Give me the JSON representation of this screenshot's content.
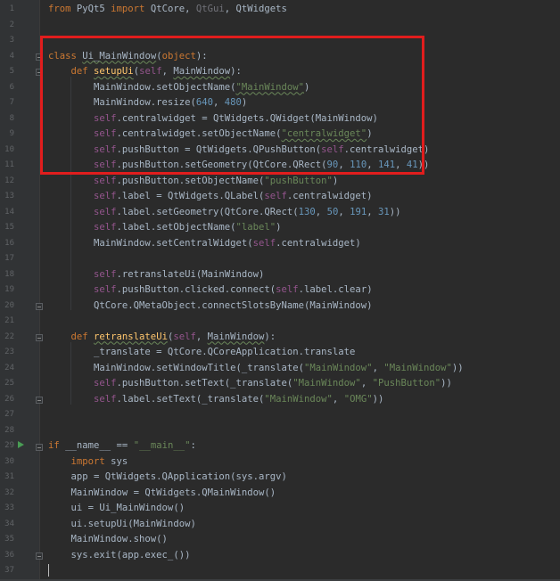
{
  "editor": {
    "line_numbers": [
      "1",
      "2",
      "3",
      "4",
      "5",
      "6",
      "7",
      "8",
      "9",
      "10",
      "11",
      "12",
      "13",
      "14",
      "15",
      "16",
      "17",
      "18",
      "19",
      "20",
      "21",
      "22",
      "23",
      "24",
      "25",
      "26",
      "27",
      "28",
      "29",
      "30",
      "31",
      "32",
      "33",
      "34",
      "35",
      "36",
      "37"
    ],
    "lines": [
      {
        "n": "1",
        "tokens": [
          {
            "t": "from ",
            "c": "kw"
          },
          {
            "t": "PyQt5 "
          },
          {
            "t": "import ",
            "c": "kw"
          },
          {
            "t": "QtCore, "
          },
          {
            "t": "QtGui",
            "c": "param"
          },
          {
            "t": ", QtWidgets"
          }
        ]
      },
      {
        "n": "2",
        "tokens": []
      },
      {
        "n": "3",
        "tokens": []
      },
      {
        "n": "4",
        "tokens": [
          {
            "t": "class ",
            "c": "kw"
          },
          {
            "t": "Ui_MainWindow",
            "c": "wave"
          },
          {
            "t": "("
          },
          {
            "t": "object",
            "c": "kw"
          },
          {
            "t": "):"
          }
        ]
      },
      {
        "n": "5",
        "tokens": [
          {
            "t": "    "
          },
          {
            "t": "def ",
            "c": "kw"
          },
          {
            "t": "setupUi",
            "c": "fn wave"
          },
          {
            "t": "("
          },
          {
            "t": "self",
            "c": "self"
          },
          {
            "t": ", "
          },
          {
            "t": "MainWindow",
            "c": "wave"
          },
          {
            "t": "):"
          }
        ]
      },
      {
        "n": "6",
        "tokens": [
          {
            "t": "        MainWindow.setObjectName("
          },
          {
            "t": "\"MainWindow\"",
            "c": "str wave"
          },
          {
            "t": ")"
          }
        ]
      },
      {
        "n": "7",
        "tokens": [
          {
            "t": "        MainWindow.resize("
          },
          {
            "t": "640",
            "c": "num"
          },
          {
            "t": ", "
          },
          {
            "t": "480",
            "c": "num"
          },
          {
            "t": ")"
          }
        ]
      },
      {
        "n": "8",
        "tokens": [
          {
            "t": "        "
          },
          {
            "t": "self",
            "c": "self"
          },
          {
            "t": ".centralwidget = QtWidgets.QWidget(MainWindow)"
          }
        ]
      },
      {
        "n": "9",
        "tokens": [
          {
            "t": "        "
          },
          {
            "t": "self",
            "c": "self"
          },
          {
            "t": ".centralwidget.setObjectName("
          },
          {
            "t": "\"centralwidget\"",
            "c": "str wave"
          },
          {
            "t": ")"
          }
        ]
      },
      {
        "n": "10",
        "tokens": [
          {
            "t": "        "
          },
          {
            "t": "self",
            "c": "self"
          },
          {
            "t": ".pushButton = QtWidgets.QPushButton("
          },
          {
            "t": "self",
            "c": "self"
          },
          {
            "t": ".centralwidget)"
          }
        ]
      },
      {
        "n": "11",
        "tokens": [
          {
            "t": "        "
          },
          {
            "t": "self",
            "c": "self"
          },
          {
            "t": ".pushButton.setGeometry(QtCore.QRect("
          },
          {
            "t": "90",
            "c": "num"
          },
          {
            "t": ", "
          },
          {
            "t": "110",
            "c": "num"
          },
          {
            "t": ", "
          },
          {
            "t": "141",
            "c": "num"
          },
          {
            "t": ", "
          },
          {
            "t": "41",
            "c": "num"
          },
          {
            "t": "))"
          }
        ]
      },
      {
        "n": "12",
        "tokens": [
          {
            "t": "        "
          },
          {
            "t": "self",
            "c": "self"
          },
          {
            "t": ".pushButton.setObjectName("
          },
          {
            "t": "\"pushButton\"",
            "c": "str"
          },
          {
            "t": ")"
          }
        ]
      },
      {
        "n": "13",
        "tokens": [
          {
            "t": "        "
          },
          {
            "t": "self",
            "c": "self"
          },
          {
            "t": ".label = QtWidgets.QLabel("
          },
          {
            "t": "self",
            "c": "self"
          },
          {
            "t": ".centralwidget)"
          }
        ]
      },
      {
        "n": "14",
        "tokens": [
          {
            "t": "        "
          },
          {
            "t": "self",
            "c": "self"
          },
          {
            "t": ".label.setGeometry(QtCore.QRect("
          },
          {
            "t": "130",
            "c": "num"
          },
          {
            "t": ", "
          },
          {
            "t": "50",
            "c": "num"
          },
          {
            "t": ", "
          },
          {
            "t": "191",
            "c": "num"
          },
          {
            "t": ", "
          },
          {
            "t": "31",
            "c": "num"
          },
          {
            "t": "))"
          }
        ]
      },
      {
        "n": "15",
        "tokens": [
          {
            "t": "        "
          },
          {
            "t": "self",
            "c": "self"
          },
          {
            "t": ".label.setObjectName("
          },
          {
            "t": "\"label\"",
            "c": "str"
          },
          {
            "t": ")"
          }
        ]
      },
      {
        "n": "16",
        "tokens": [
          {
            "t": "        MainWindow.setCentralWidget("
          },
          {
            "t": "self",
            "c": "self"
          },
          {
            "t": ".centralwidget)"
          }
        ]
      },
      {
        "n": "17",
        "tokens": []
      },
      {
        "n": "18",
        "tokens": [
          {
            "t": "        "
          },
          {
            "t": "self",
            "c": "self"
          },
          {
            "t": ".retranslateUi(MainWindow)"
          }
        ]
      },
      {
        "n": "19",
        "tokens": [
          {
            "t": "        "
          },
          {
            "t": "self",
            "c": "self"
          },
          {
            "t": ".pushButton.clicked.connect("
          },
          {
            "t": "self",
            "c": "self"
          },
          {
            "t": ".label.clear)"
          }
        ]
      },
      {
        "n": "20",
        "tokens": [
          {
            "t": "        QtCore.QMetaObject.connectSlotsByName(MainWindow)"
          }
        ]
      },
      {
        "n": "21",
        "tokens": []
      },
      {
        "n": "22",
        "tokens": [
          {
            "t": "    "
          },
          {
            "t": "def ",
            "c": "kw"
          },
          {
            "t": "retranslateUi",
            "c": "fn wave"
          },
          {
            "t": "("
          },
          {
            "t": "self",
            "c": "self"
          },
          {
            "t": ", "
          },
          {
            "t": "MainWindow",
            "c": "wave"
          },
          {
            "t": "):"
          }
        ]
      },
      {
        "n": "23",
        "tokens": [
          {
            "t": "        _translate = QtCore.QCoreApplication.translate"
          }
        ]
      },
      {
        "n": "24",
        "tokens": [
          {
            "t": "        MainWindow.setWindowTitle(_translate("
          },
          {
            "t": "\"MainWindow\"",
            "c": "str"
          },
          {
            "t": ", "
          },
          {
            "t": "\"MainWindow\"",
            "c": "str"
          },
          {
            "t": "))"
          }
        ]
      },
      {
        "n": "25",
        "tokens": [
          {
            "t": "        "
          },
          {
            "t": "self",
            "c": "self"
          },
          {
            "t": ".pushButton.setText(_translate("
          },
          {
            "t": "\"MainWindow\"",
            "c": "str"
          },
          {
            "t": ", "
          },
          {
            "t": "\"PushButton\"",
            "c": "str"
          },
          {
            "t": "))"
          }
        ]
      },
      {
        "n": "26",
        "tokens": [
          {
            "t": "        "
          },
          {
            "t": "self",
            "c": "self"
          },
          {
            "t": ".label.setText(_translate("
          },
          {
            "t": "\"MainWindow\"",
            "c": "str"
          },
          {
            "t": ", "
          },
          {
            "t": "\"OMG\"",
            "c": "str"
          },
          {
            "t": "))"
          }
        ]
      },
      {
        "n": "27",
        "tokens": []
      },
      {
        "n": "28",
        "tokens": []
      },
      {
        "n": "29",
        "tokens": [
          {
            "t": "if ",
            "c": "kw"
          },
          {
            "t": "__name__ "
          },
          {
            "t": "== "
          },
          {
            "t": "\"__main__\"",
            "c": "str"
          },
          {
            "t": ":"
          }
        ]
      },
      {
        "n": "30",
        "tokens": [
          {
            "t": "    "
          },
          {
            "t": "import ",
            "c": "kw"
          },
          {
            "t": "sys"
          }
        ]
      },
      {
        "n": "31",
        "tokens": [
          {
            "t": "    app = QtWidgets.QApplication(sys.argv)"
          }
        ]
      },
      {
        "n": "32",
        "tokens": [
          {
            "t": "    MainWindow = QtWidgets.QMainWindow()"
          }
        ]
      },
      {
        "n": "33",
        "tokens": [
          {
            "t": "    ui = Ui_MainWindow()"
          }
        ]
      },
      {
        "n": "34",
        "tokens": [
          {
            "t": "    ui.setupUi(MainWindow)"
          }
        ]
      },
      {
        "n": "35",
        "tokens": [
          {
            "t": "    MainWindow.show()"
          }
        ]
      },
      {
        "n": "36",
        "tokens": [
          {
            "t": "    sys.exit(app.exec_())"
          }
        ]
      },
      {
        "n": "37",
        "tokens": []
      }
    ]
  },
  "colors": {
    "background": "#2b2b2b",
    "keyword": "#cc7832",
    "self": "#94558d",
    "string": "#6a8759",
    "function": "#ffc66d",
    "number": "#6897bb",
    "highlight_box": "#e11d1d"
  },
  "icons": {
    "run_gutter": "run-triangle-icon",
    "fold": "fold-marker-icon"
  }
}
